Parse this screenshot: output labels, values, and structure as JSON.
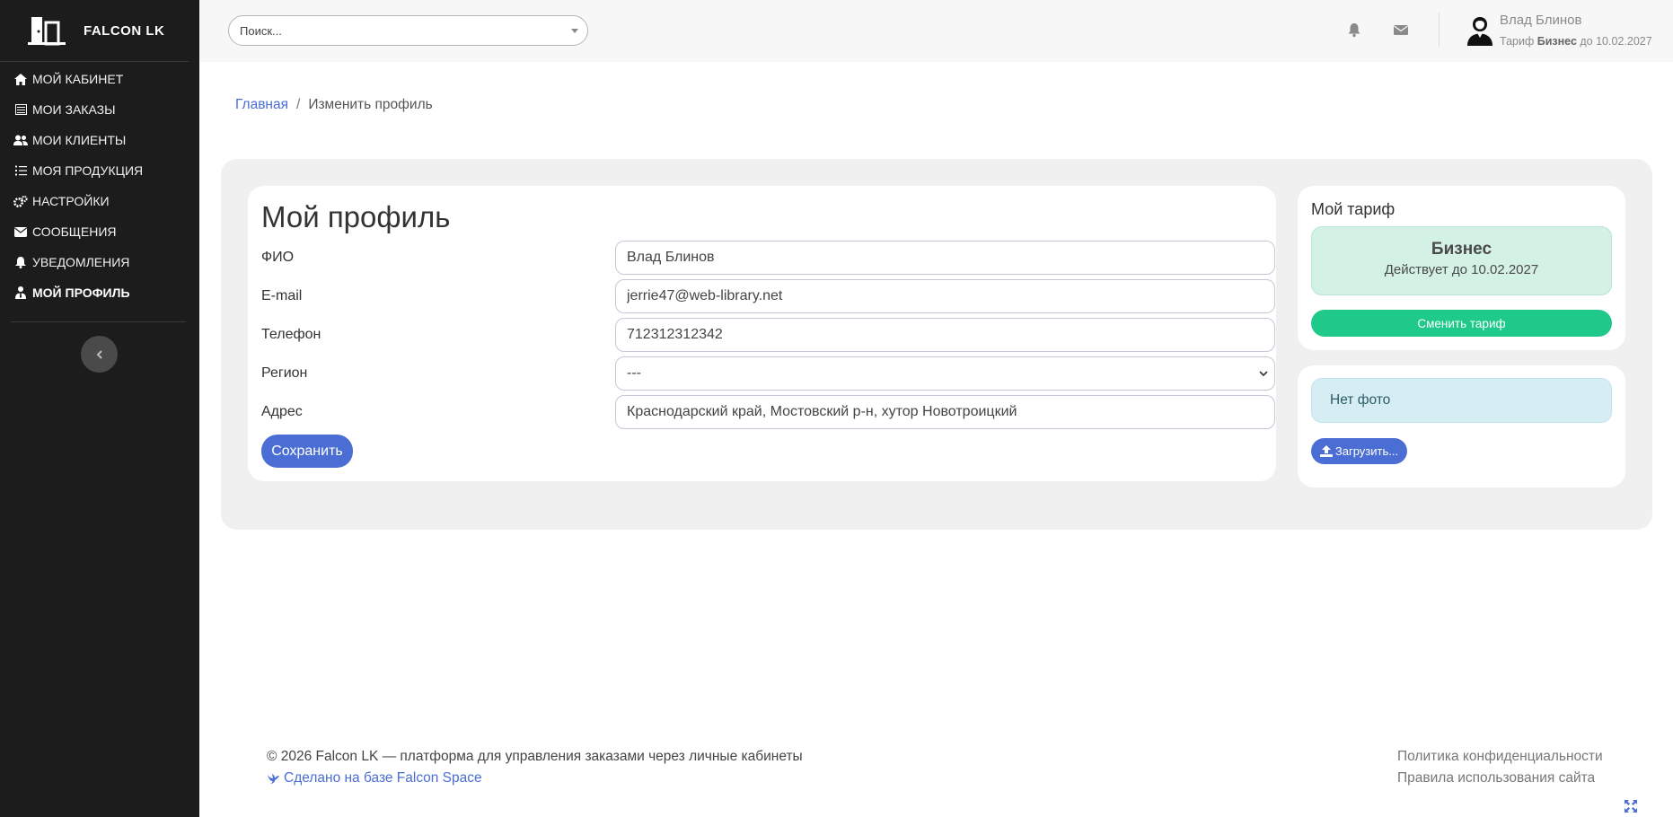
{
  "brand": {
    "name": "FALCON LK"
  },
  "sidebar": {
    "items": [
      {
        "label": "МОЙ КАБИНЕТ",
        "icon": "home-icon"
      },
      {
        "label": "МОИ ЗАКАЗЫ",
        "icon": "list-alt-icon"
      },
      {
        "label": "МОИ КЛИЕНТЫ",
        "icon": "users-icon"
      },
      {
        "label": "МОЯ ПРОДУКЦИЯ",
        "icon": "tasks-icon"
      },
      {
        "label": "НАСТРОЙКИ",
        "icon": "cogs-icon"
      },
      {
        "label": "СООБЩЕНИЯ",
        "icon": "envelope-icon"
      },
      {
        "label": "УВЕДОМЛЕНИЯ",
        "icon": "bell-icon"
      },
      {
        "label": "МОЙ ПРОФИЛЬ",
        "icon": "user-tie-icon",
        "active": true
      }
    ]
  },
  "header": {
    "search_placeholder": "Поиск...",
    "user_name": "Влад Блинов",
    "tariff_prefix": "Тариф",
    "tariff_name": "Бизнес",
    "tariff_suffix": "до 10.02.2027"
  },
  "breadcrumb": {
    "home": "Главная",
    "separator": "/",
    "current": "Изменить профиль"
  },
  "profile": {
    "title": "Мой профиль",
    "fields": {
      "fio": {
        "label": "ФИО",
        "value": "Влад Блинов"
      },
      "email": {
        "label": "E-mail",
        "value": "jerrie47@web-library.net"
      },
      "phone": {
        "label": "Телефон",
        "value": "712312312342"
      },
      "region": {
        "label": "Регион",
        "value": "---"
      },
      "address": {
        "label": "Адрес",
        "value": "Краснодарский край, Мостовский р-н, хутор Новотроицкий"
      }
    },
    "save_label": "Сохранить"
  },
  "tariff": {
    "title": "Мой тариф",
    "name": "Бизнес",
    "valid_until": "Действует до 10.02.2027",
    "change_label": "Сменить тариф"
  },
  "photo": {
    "status": "Нет фото",
    "upload_label": "Загрузить..."
  },
  "footer": {
    "copyright": "© 2026 Falcon LK — платформа для управления заказами через личные кабинеты",
    "made_with": "Сделано на базе Falcon Space",
    "privacy": "Политика конфиденциальности",
    "terms": "Правила использования сайта"
  },
  "colors": {
    "sidebar_bg": "#1c1c1c",
    "accent_blue": "#4a6ed3",
    "accent_green": "#1ec98a",
    "tariff_box_bg": "#d3f1e4",
    "photo_box_bg": "#d6eef3"
  }
}
